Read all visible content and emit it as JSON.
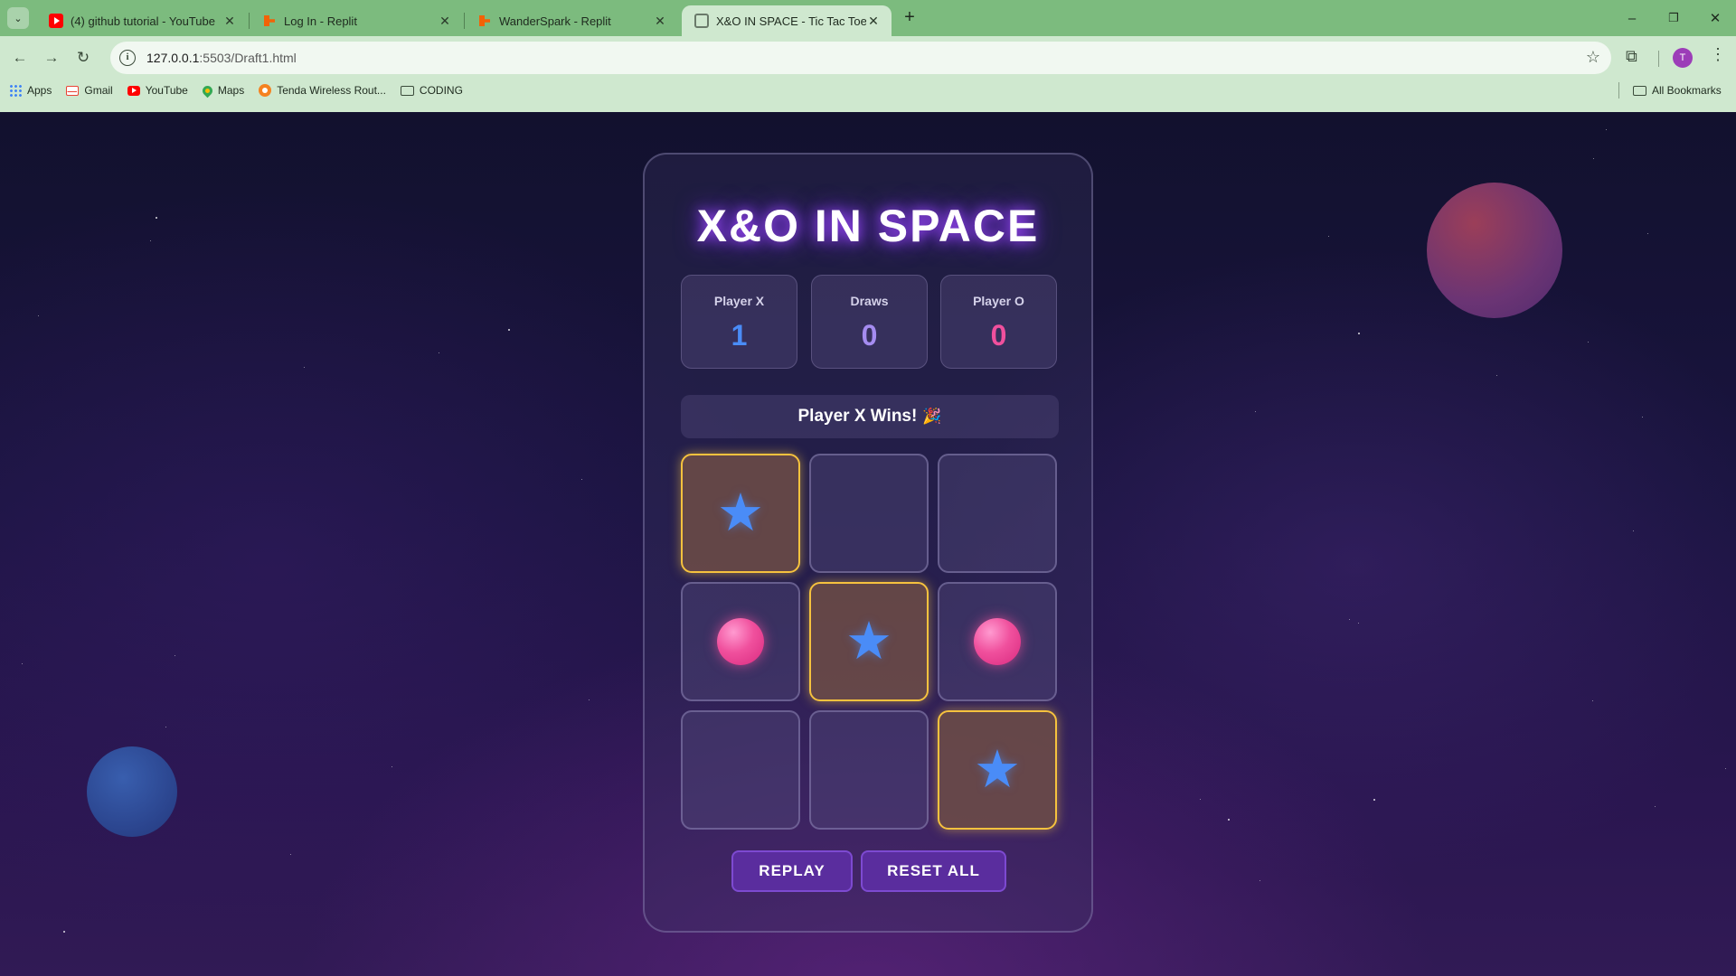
{
  "browser": {
    "tab_list_icon": "chevron-down-icon",
    "tabs": [
      {
        "title": "(4) github tutorial - YouTube",
        "favicon": "youtube-icon"
      },
      {
        "title": "Log In - Replit",
        "favicon": "replit-icon"
      },
      {
        "title": "WanderSpark - Replit",
        "favicon": "replit-icon"
      },
      {
        "title": "X&O IN SPACE - Tic Tac Toe",
        "favicon": "globe-icon",
        "active": true
      }
    ],
    "new_tab_label": "+",
    "window_controls": {
      "minimize": "–",
      "restore": "❐",
      "close": "✕"
    },
    "address": {
      "host": "127.0.0.1",
      "rest": ":5503/Draft1.html"
    },
    "profile_initial": "T",
    "bookmarks": [
      {
        "label": "Apps",
        "icon": "apps-grid-icon"
      },
      {
        "label": "Gmail",
        "icon": "gmail-icon"
      },
      {
        "label": "YouTube",
        "icon": "youtube-icon"
      },
      {
        "label": "Maps",
        "icon": "maps-icon"
      },
      {
        "label": "Tenda Wireless Rout...",
        "icon": "tenda-icon"
      },
      {
        "label": "CODING",
        "icon": "folder-icon"
      }
    ],
    "all_bookmarks_label": "All Bookmarks"
  },
  "game": {
    "title": "X&O IN SPACE",
    "scores": {
      "player_x": {
        "label": "Player X",
        "value": "1",
        "color": "#4a8cf7"
      },
      "draws": {
        "label": "Draws",
        "value": "0",
        "color": "#a58cf0"
      },
      "player_o": {
        "label": "Player O",
        "value": "0",
        "color": "#f0509d"
      }
    },
    "status": "Player X Wins!",
    "status_emoji": "🎉",
    "board": [
      "X",
      "",
      "",
      "O",
      "X",
      "O",
      "",
      "",
      "X"
    ],
    "winning_cells": [
      0,
      4,
      8
    ],
    "x_symbol": "★",
    "colors": {
      "x": "#4a8cf7",
      "o": "#f0509d",
      "win_border": "#f6c23e",
      "button": "#5a2d9e"
    },
    "buttons": {
      "replay": "REPLAY",
      "reset": "RESET ALL"
    }
  }
}
